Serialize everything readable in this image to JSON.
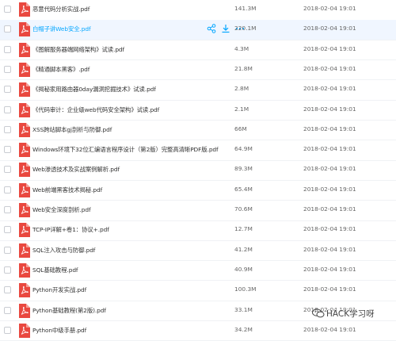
{
  "files": [
    {
      "name": "恶意代码分析实战.pdf",
      "size": "141.3M",
      "date": "2018-02-04 19:01"
    },
    {
      "name": "白帽子讲Web安全.pdf",
      "size": "220.1M",
      "date": "2018-02-04 19:01",
      "highlighted": true
    },
    {
      "name": "《图解服务器端网络架构》试读.pdf",
      "size": "4.3M",
      "date": "2018-02-04 19:01"
    },
    {
      "name": "《精通脚本黑客》.pdf",
      "size": "21.8M",
      "date": "2018-02-04 19:01"
    },
    {
      "name": "《揭秘家用路由器0day漏洞挖掘技术》试读.pdf",
      "size": "2.8M",
      "date": "2018-02-04 19:01"
    },
    {
      "name": "《代码审计：企业级web代码安全架构》试读.pdf",
      "size": "2.1M",
      "date": "2018-02-04 19:01"
    },
    {
      "name": "XSS跨站脚本gj剖析与防御.pdf",
      "size": "66M",
      "date": "2018-02-04 19:01"
    },
    {
      "name": "Windows环境下32位汇编语言程序设计（第2版）完整高清晰PDF版.pdf",
      "size": "64.9M",
      "date": "2018-02-04 19:01"
    },
    {
      "name": "Web渗透技术及实战案例解析.pdf",
      "size": "89.3M",
      "date": "2018-02-04 19:01"
    },
    {
      "name": "Web前端黑客技术揭秘.pdf",
      "size": "65.4M",
      "date": "2018-02-04 19:01"
    },
    {
      "name": "Web安全深度剖析.pdf",
      "size": "70.6M",
      "date": "2018-02-04 19:01"
    },
    {
      "name": "TCP-IP详解+卷1：协议+.pdf",
      "size": "12.7M",
      "date": "2018-02-04 19:01"
    },
    {
      "name": "SQL注入攻击与防御.pdf",
      "size": "41.2M",
      "date": "2018-02-04 19:01"
    },
    {
      "name": "SQL基础教程.pdf",
      "size": "40.9M",
      "date": "2018-02-04 19:01"
    },
    {
      "name": "Python开发实战.pdf",
      "size": "100.3M",
      "date": "2018-02-04 19:01"
    },
    {
      "name": "Python基础教程(第2版).pdf",
      "size": "33.1M",
      "date": "2018-02-04 19:01"
    },
    {
      "name": "Python中级手册.pdf",
      "size": "34.2M",
      "date": "2018-02-04 19:01"
    }
  ],
  "row_actions": {
    "share_icon": "share-icon",
    "download_icon": "download-icon",
    "more_icon": "more-icon"
  },
  "watermark": {
    "text": "HACK学习呀"
  },
  "colors": {
    "pdf_red": "#e9483f",
    "highlight_bg": "#f0f6ff",
    "highlight_text": "#06a7ff",
    "action_blue": "#06a7ff"
  }
}
